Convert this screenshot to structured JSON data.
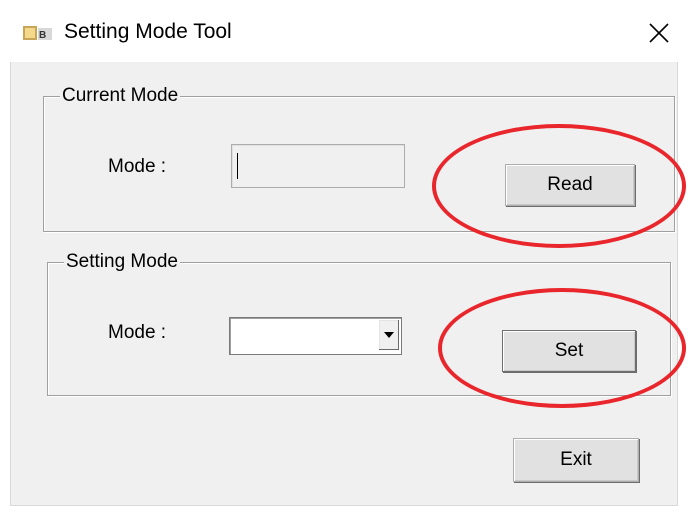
{
  "window": {
    "title": "Setting Mode Tool",
    "close_label": "×"
  },
  "current_mode": {
    "group_label": "Current Mode",
    "mode_label": "Mode :",
    "mode_value": "",
    "read_button_label": "Read"
  },
  "setting_mode": {
    "group_label": "Setting Mode",
    "mode_label": "Mode :",
    "selected_value": "",
    "set_button_label": "Set"
  },
  "exit_button_label": "Exit",
  "colors": {
    "highlight_ring": "#e8262b",
    "dialog_background": "#f0f0f0"
  },
  "icons": {
    "app_icon": "app-logo-icon",
    "close": "close-icon",
    "dropdown_arrow": "chevron-down-icon"
  }
}
